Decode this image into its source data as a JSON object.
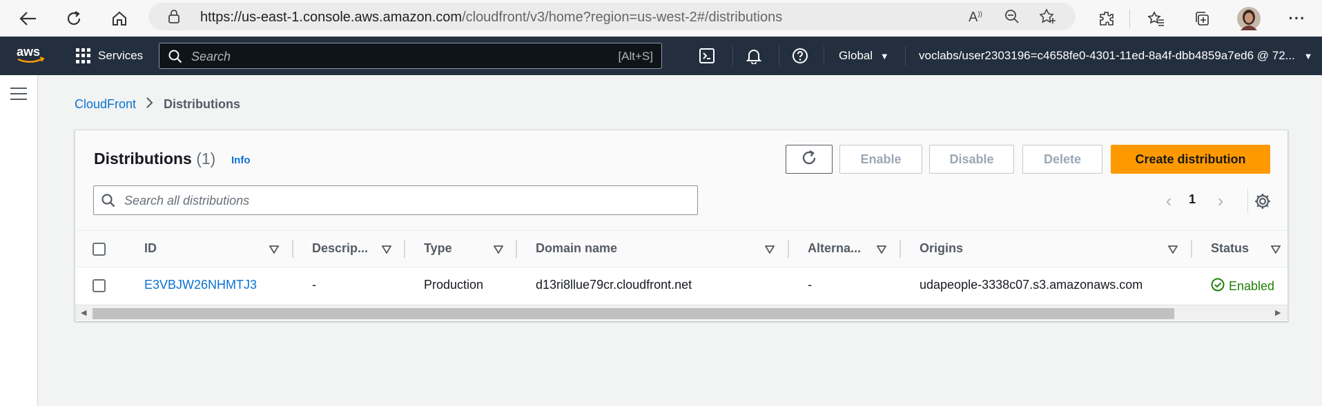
{
  "browser": {
    "url_host": "https://us-east-1.console.aws.amazon.com",
    "url_path": "/cloudfront/v3/home?region=us-west-2#/distributions"
  },
  "aws_nav": {
    "logo_text": "aws",
    "services_label": "Services",
    "search_placeholder": "Search",
    "search_shortcut": "[Alt+S]",
    "region_label": "Global",
    "account_label": "voclabs/user2303196=c4658fe0-4301-11ed-8a4f-dbb4859a7ed6 @ 72..."
  },
  "breadcrumb": {
    "root": "CloudFront",
    "current": "Distributions"
  },
  "panel": {
    "title": "Distributions",
    "count": "(1)",
    "info_label": "Info",
    "buttons": {
      "enable": "Enable",
      "disable": "Disable",
      "delete": "Delete",
      "create": "Create distribution"
    },
    "search_placeholder": "Search all distributions",
    "page_number": "1"
  },
  "table": {
    "columns": [
      "ID",
      "Descrip...",
      "Type",
      "Domain name",
      "Alterna...",
      "Origins",
      "Status"
    ],
    "rows": [
      {
        "id": "E3VBJW26NHMTJ3",
        "description": "-",
        "type": "Production",
        "domain": "d13ri8llue79cr.cloudfront.net",
        "alternate": "-",
        "origins": "udapeople-3338c07.s3.amazonaws.com",
        "status": "Enabled"
      }
    ]
  },
  "colors": {
    "nav_bg": "#232f3e",
    "primary": "#ff9900",
    "link": "#0972d3",
    "success": "#1d8102"
  }
}
